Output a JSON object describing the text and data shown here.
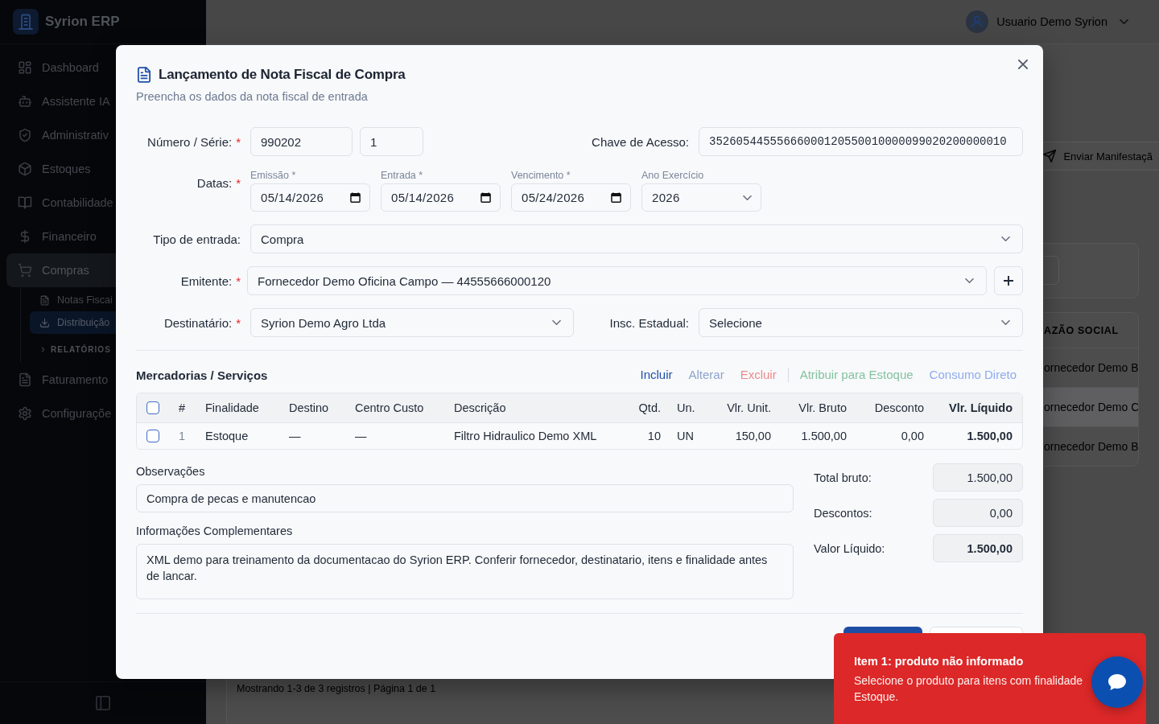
{
  "sidebar": {
    "brand": "Syrion ERP",
    "items": [
      {
        "label": "Dashboard",
        "selected": false
      },
      {
        "label": "Assistente IA",
        "selected": false
      },
      {
        "label": "Administrativ",
        "selected": false
      },
      {
        "label": "Estoques",
        "selected": false
      },
      {
        "label": "Contabilidade",
        "selected": false
      },
      {
        "label": "Financeiro",
        "selected": false
      },
      {
        "label": "Compras",
        "selected": true,
        "children": [
          {
            "kind": "link",
            "label": "Notas Fiscai",
            "selected": false
          },
          {
            "kind": "link",
            "label": "Distribuição",
            "selected": true
          },
          {
            "kind": "group",
            "label": "RELATÓRIOS",
            "expanded": false
          }
        ]
      },
      {
        "label": "Faturamento",
        "selected": false
      },
      {
        "label": "Configuraçõe",
        "selected": false
      }
    ]
  },
  "header": {
    "user": "Usuario Demo Syrion"
  },
  "page": {
    "action_button": "Enviar Manifestaçã",
    "table": {
      "columns": [
        "AZÃO SOCIAL"
      ],
      "rows": [
        {
          "selected": false,
          "cells": [
            "ornecedor Demo B"
          ]
        },
        {
          "selected": true,
          "cells": [
            "ornecedor Demo C"
          ]
        },
        {
          "selected": false,
          "cells": [
            "ornecedor Demo B"
          ]
        }
      ]
    },
    "footer": "Mostrando 1-3 de 3 registros | Página 1 de 1"
  },
  "modal": {
    "title": "Lançamento de Nota Fiscal de Compra",
    "subtitle": "Preencha os dados da nota fiscal de entrada",
    "numero_serie": {
      "label": "Número / Série:",
      "required_mark": "*",
      "numero": "990202",
      "serie": "1"
    },
    "chave_acesso": {
      "label": "Chave de Acesso:",
      "value": "35260544555666000120550010000099020200000010"
    },
    "datas": {
      "label": "Datas:",
      "required_mark": "*",
      "fields": [
        {
          "kind": "date",
          "label": "Emissão *",
          "value": "05/14/2026"
        },
        {
          "kind": "date",
          "label": "Entrada *",
          "value": "05/14/2026"
        },
        {
          "kind": "date",
          "label": "Vencimento *",
          "value": "05/24/2026"
        },
        {
          "kind": "select",
          "label": "Ano Exercício",
          "value": "2026"
        }
      ]
    },
    "tipo_entrada": {
      "label": "Tipo de entrada:",
      "value": "Compra"
    },
    "emitente": {
      "label": "Emitente:",
      "required_mark": "*",
      "value": "Fornecedor Demo Oficina Campo — 44555666000120"
    },
    "destinatario": {
      "label": "Destinatário:",
      "required_mark": "*",
      "value": "Syrion Demo Agro Ltda"
    },
    "insc_estadual": {
      "label": "Insc. Estadual:",
      "value": "Selecione"
    },
    "items_section": {
      "title": "Mercadorias / Serviços",
      "action_groups": [
        {
          "actions": [
            {
              "label": "Incluir",
              "color": "#1e4fa8"
            },
            {
              "label": "Alterar",
              "color": "#8ea4ca"
            },
            {
              "label": "Excluir",
              "color": "#e98b8c"
            }
          ]
        },
        {
          "actions": [
            {
              "label": "Atribuir para Estoque",
              "color": "#84c2a0"
            },
            {
              "label": "Consumo Direto",
              "color": "#8eaaef"
            }
          ]
        }
      ],
      "table": {
        "header_checked": false,
        "columns": [
          "#",
          "Finalidade",
          "Destino",
          "Centro Custo",
          "Descrição",
          "Qtd.",
          "Un.",
          "Vlr. Unit.",
          "Vlr. Bruto",
          "Desconto",
          "Vlr. Líquido"
        ],
        "rows": [
          {
            "selected": false,
            "cells": [
              "1",
              "Estoque",
              "—",
              "—",
              "Filtro Hidraulico Demo XML",
              "10",
              "UN",
              "150,00",
              "1.500,00",
              "0,00",
              "1.500,00"
            ]
          }
        ]
      }
    },
    "observacoes": {
      "label": "Observações",
      "value": "Compra de pecas e manutencao"
    },
    "informacoes": {
      "label": "Informações Complementares",
      "value": "XML demo para treinamento da documentacao do Syrion ERP. Conferir fornecedor, destinatario, itens e finalidade antes de lancar."
    },
    "totals": [
      {
        "label": "Total bruto:",
        "value": "1.500,00"
      },
      {
        "label": "Descontos:",
        "value": "0,00"
      },
      {
        "label": "Valor Líquido:",
        "value": "1.500,00"
      }
    ],
    "buttons": [
      {
        "kind": "primary"
      },
      {
        "kind": "secondary"
      }
    ]
  },
  "toast": {
    "title": "Item 1: produto não informado",
    "message": "Selecione o produto para itens com finalidade Estoque."
  }
}
